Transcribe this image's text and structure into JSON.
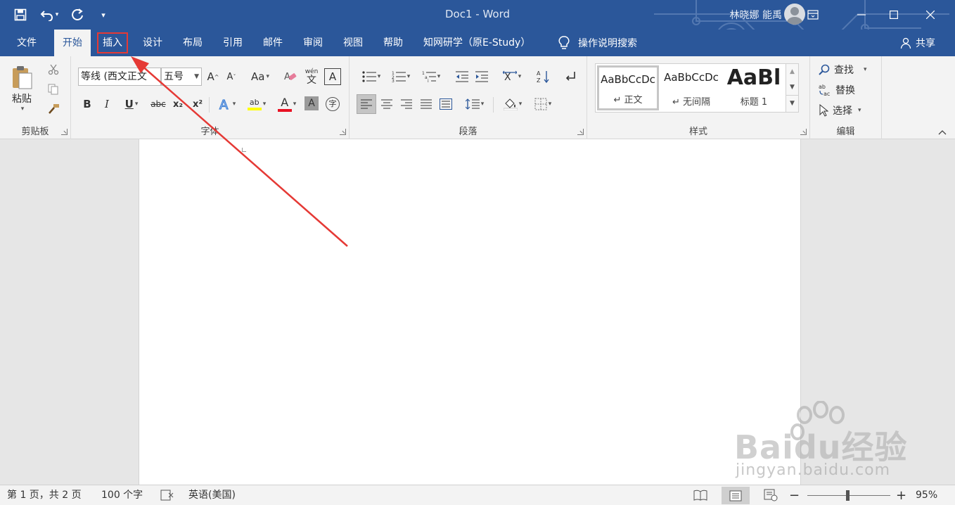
{
  "window": {
    "title": "Doc1  -  Word",
    "user": "林晓娜 能禹"
  },
  "tabs": [
    {
      "label": "文件"
    },
    {
      "label": "开始"
    },
    {
      "label": "插入"
    },
    {
      "label": "设计"
    },
    {
      "label": "布局"
    },
    {
      "label": "引用"
    },
    {
      "label": "邮件"
    },
    {
      "label": "审阅"
    },
    {
      "label": "视图"
    },
    {
      "label": "帮助"
    },
    {
      "label": "知网研学（原E-Study）"
    }
  ],
  "active_tab": "开始",
  "highlighted_tab": "插入",
  "tellme": {
    "label": "操作说明搜索"
  },
  "share": {
    "label": "共享"
  },
  "clipboard": {
    "label": "剪贴板",
    "paste": "粘贴"
  },
  "font": {
    "label": "字体",
    "name": "等线 (西文正文",
    "size": "五号",
    "change_case": "Aa",
    "phonetic": "wén",
    "phonetic_char": "文",
    "border_char": "A",
    "bold": "B",
    "italic": "I",
    "underline": "U",
    "strike": "abc",
    "subscript": "x₂",
    "superscript": "x²",
    "enclose_char": "字",
    "highlight_text": "ab"
  },
  "paragraph": {
    "label": "段落"
  },
  "styles": {
    "label": "样式",
    "items": [
      {
        "sample": "AaBbCcDc",
        "name": "↵ 正文"
      },
      {
        "sample": "AaBbCcDc",
        "name": "↵ 无间隔"
      },
      {
        "sample": "AaBl",
        "name": "标题 1"
      }
    ]
  },
  "editing": {
    "label": "编辑",
    "find": "查找",
    "replace": "替换",
    "select": "选择"
  },
  "status": {
    "page": "第 1 页，共 2 页",
    "words": "100 个字",
    "language": "英语(美国)",
    "zoom": "95%"
  },
  "watermark": {
    "brand": "Baidu经验",
    "url": "jingyan.baidu.com"
  },
  "colors": {
    "accent": "#2b579a",
    "annotation": "#e53935",
    "highlight_yellow": "#ffff00",
    "font_red": "#e81123"
  }
}
